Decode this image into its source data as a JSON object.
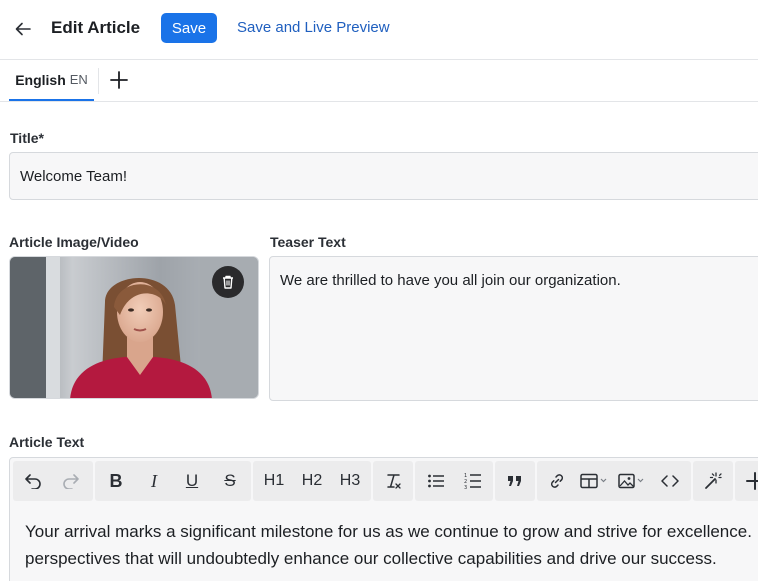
{
  "header": {
    "title": "Edit Article",
    "save_label": "Save",
    "preview_label": "Save and Live Preview",
    "accent_color": "#1a73e8"
  },
  "tabs": [
    {
      "label": "English",
      "code": "EN",
      "active": true
    }
  ],
  "title_field": {
    "label": "Title*",
    "value": "Welcome Team!"
  },
  "media_field": {
    "label": "Article Image/Video"
  },
  "teaser_field": {
    "label": "Teaser Text",
    "value": "We are thrilled to have you all join our organization."
  },
  "article_field": {
    "label": "Article Text",
    "toolbar": {
      "h1": "H1",
      "h2": "H2",
      "h3": "H3"
    },
    "body_lines": [
      "Your arrival marks a significant milestone for us as we continue to grow and strive for excellence.",
      "perspectives that will undoubtedly enhance our collective capabilities and drive our success."
    ]
  }
}
